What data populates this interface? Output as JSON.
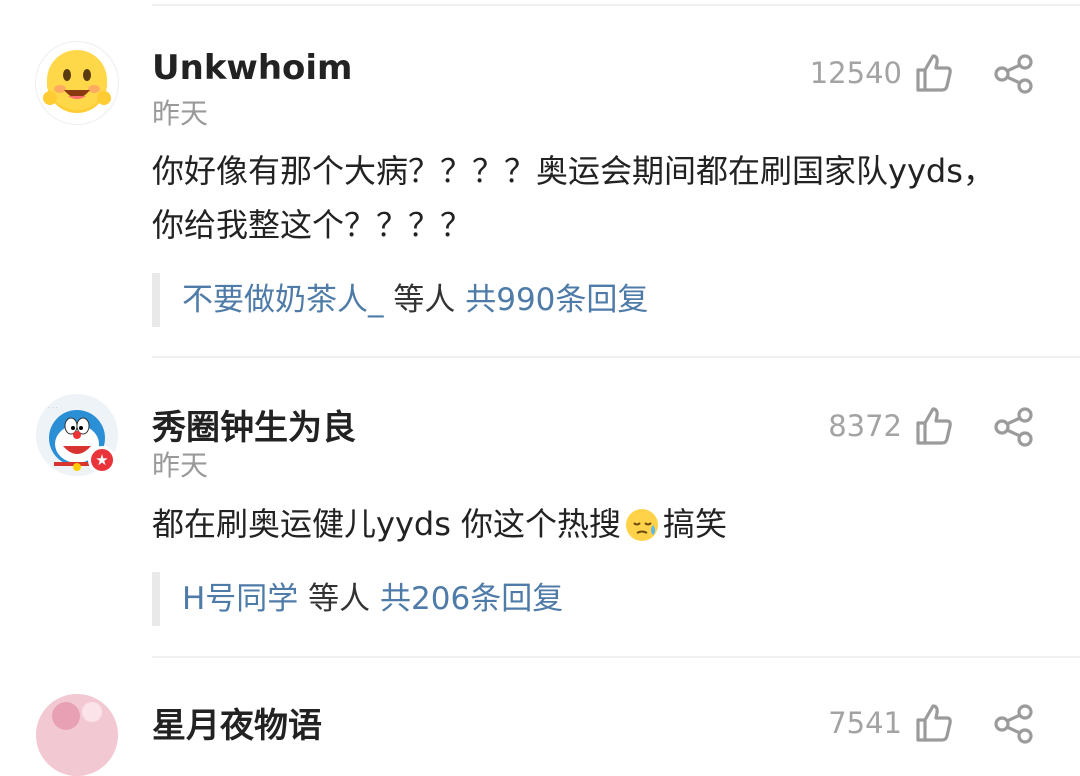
{
  "comments": [
    {
      "username": "Unkwhoim",
      "time": "昨天",
      "likes": "12540",
      "text_line1": "你好像有那个大病？？？？奥运会期间都在刷国家队yyds，",
      "text_line2": "你给我整这个？？？？",
      "reply": {
        "users": "不要做奶茶人_",
        "middle": " 等人 ",
        "total": "共990条回复"
      },
      "avatar_icon": "smiling-face-emoji-icon"
    },
    {
      "username": "秀圈钟生为良",
      "time": "昨天",
      "likes": "8372",
      "text_before": "都在刷奥运健儿yyds 你这个热搜",
      "text_after": "搞笑",
      "emoji_icon": "sweat-face-emoji-icon",
      "reply": {
        "users": "H号同学",
        "middle": " 等人 ",
        "total": "共206条回复"
      },
      "avatar_icon": "doraemon-icon",
      "badge_icon": "star-badge-icon"
    },
    {
      "username": "星月夜物语",
      "likes": "7541",
      "avatar_icon": "user-avatar-icon"
    }
  ],
  "colors": {
    "link": "#4f7ba8",
    "badge": "#e8343a",
    "muted": "#9a9a9a"
  }
}
